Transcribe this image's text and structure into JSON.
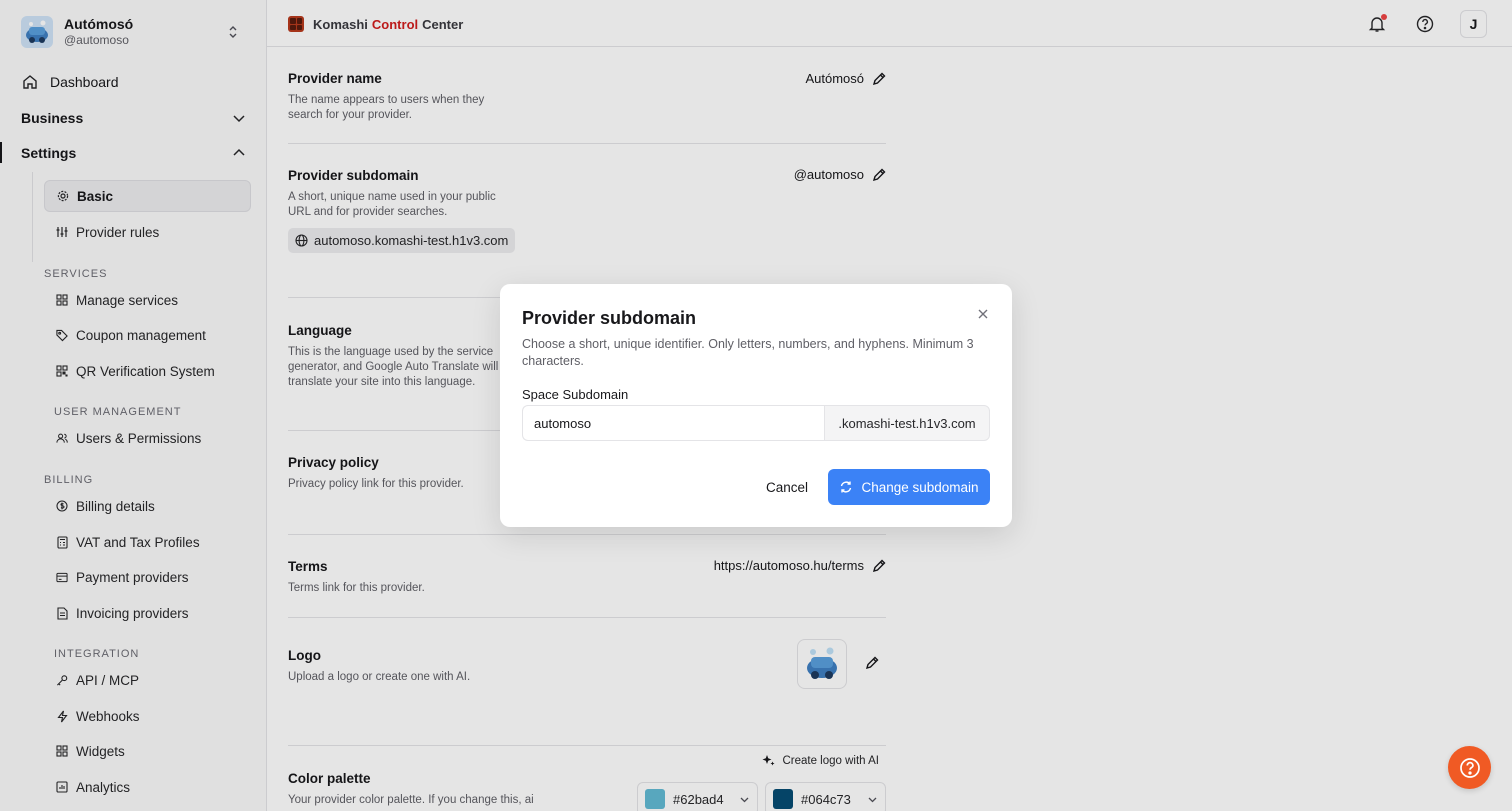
{
  "org": {
    "name": "Autómosó",
    "handle": "@automoso"
  },
  "nav": {
    "dashboard": "Dashboard",
    "business": "Business",
    "settings": "Settings",
    "basic": "Basic",
    "provider_rules": "Provider rules",
    "services_label": "SERVICES",
    "manage_services": "Manage services",
    "coupon_management": "Coupon management",
    "qr_verification": "QR Verification System",
    "user_mgmt_label": "USER MANAGEMENT",
    "users_permissions": "Users & Permissions",
    "billing_label": "BILLING",
    "billing_details": "Billing details",
    "vat_tax": "VAT and Tax Profiles",
    "payment_providers": "Payment providers",
    "invoicing_providers": "Invoicing providers",
    "integration_label": "INTEGRATION",
    "api_mcp": "API / MCP",
    "webhooks": "Webhooks",
    "widgets": "Widgets",
    "analytics": "Analytics"
  },
  "header": {
    "brand_pre": "Komashi",
    "brand_accent": "Control",
    "brand_post": "Center",
    "user_initial": "J"
  },
  "settings": {
    "provider_name": {
      "title": "Provider name",
      "desc": "The name appears to users when they search for your provider.",
      "value": "Autómosó"
    },
    "provider_subdomain": {
      "title": "Provider subdomain",
      "desc": "A short, unique name used in your public URL and for provider searches.",
      "value": "@automoso",
      "url": "automoso.komashi-test.h1v3.com"
    },
    "language": {
      "title": "Language",
      "desc": "This is the language used by the service generator, and Google Auto Translate will translate your site into this language."
    },
    "privacy": {
      "title": "Privacy policy",
      "desc": "Privacy policy link for this provider."
    },
    "terms": {
      "title": "Terms",
      "desc": "Terms link for this provider.",
      "value": "https://automoso.hu/terms"
    },
    "logo": {
      "title": "Logo",
      "desc": "Upload a logo or create one with AI.",
      "ai_button": "Create logo with AI"
    },
    "color_palette": {
      "title": "Color palette",
      "desc": "Your provider color palette. If you change this, ai",
      "primary": "#62bad4",
      "secondary": "#064c73"
    }
  },
  "dialog": {
    "title": "Provider subdomain",
    "description": "Choose a short, unique identifier. Only letters, numbers, and hyphens. Minimum 3 characters.",
    "field_label": "Space Subdomain",
    "field_value": "automoso",
    "suffix": ".komashi-test.h1v3.com",
    "cancel": "Cancel",
    "confirm": "Change subdomain"
  },
  "colors": {
    "accent": "#3b82f6",
    "fab": "#f05a24",
    "brand_red": "#d21e1e"
  }
}
